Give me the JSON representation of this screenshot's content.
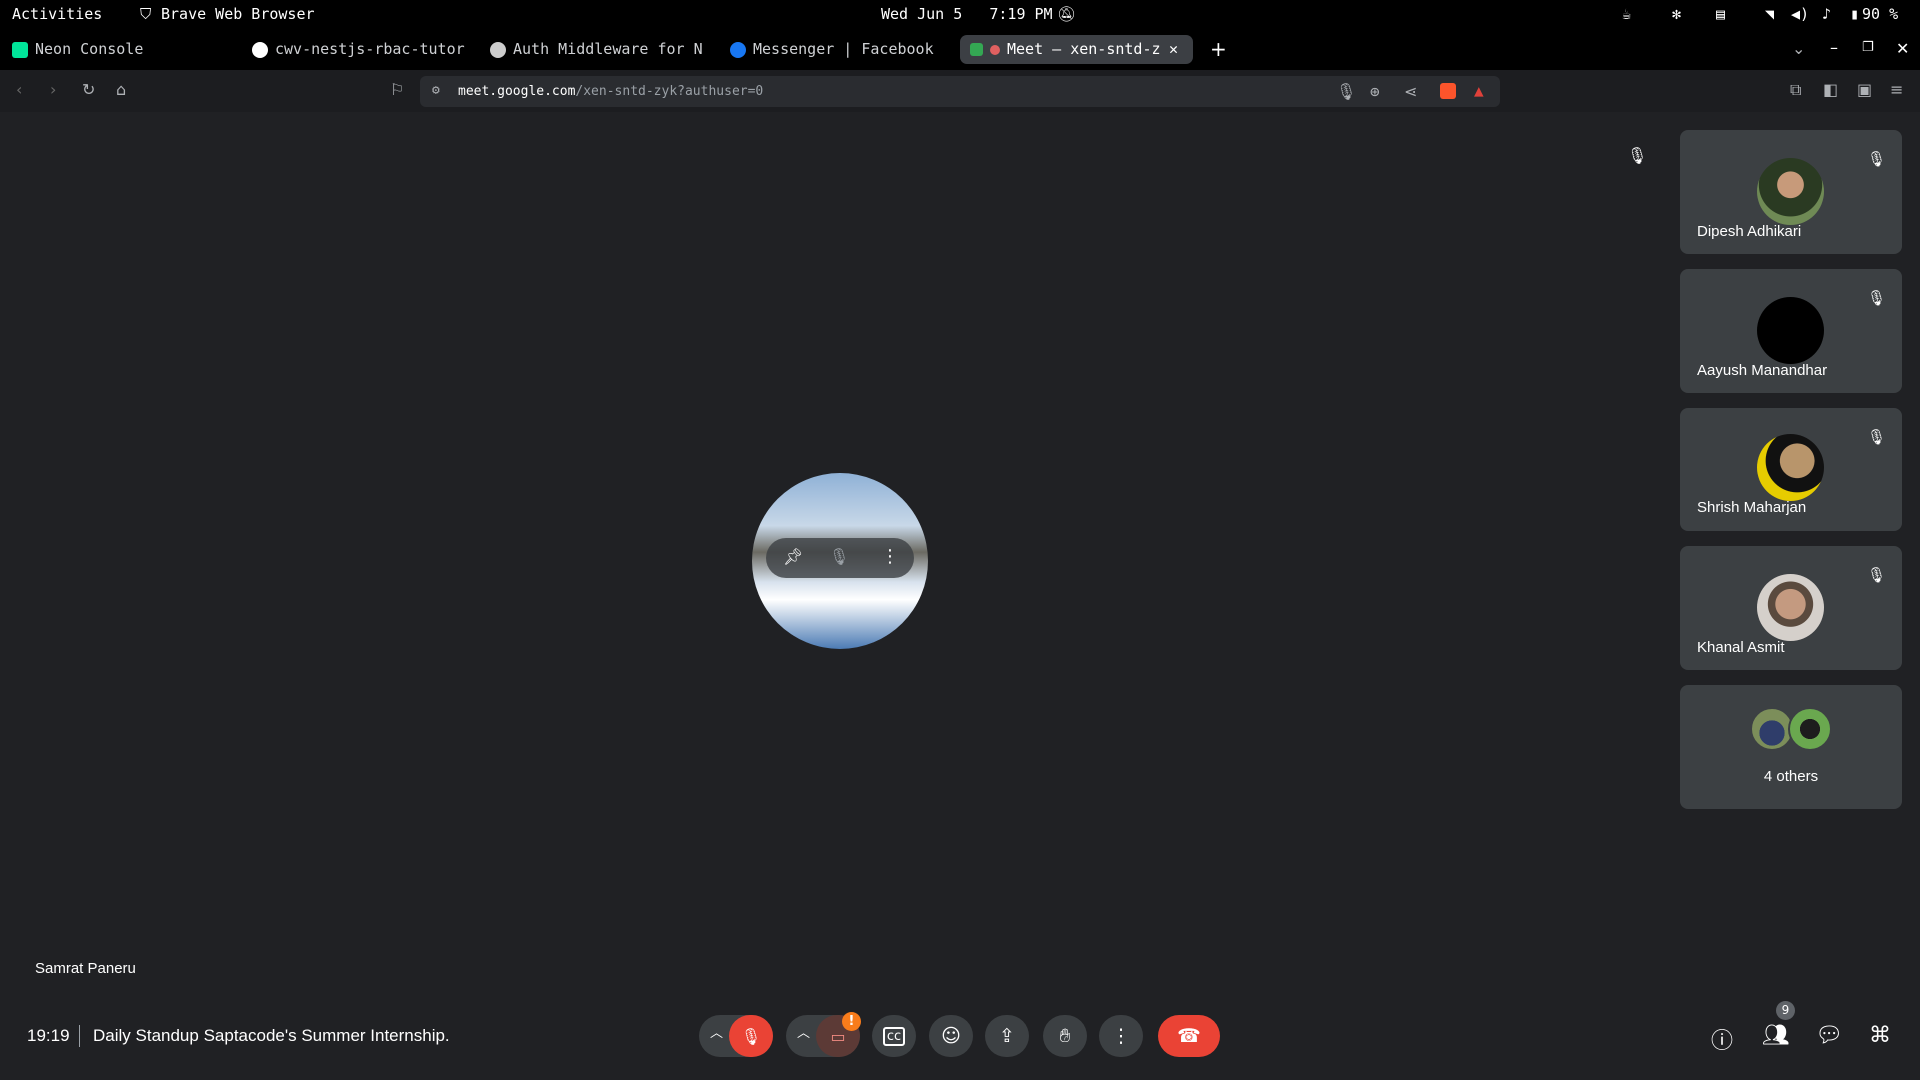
{
  "system": {
    "activities": "Activities",
    "app_name": "Brave Web Browser",
    "clock": "Wed Jun 5   7:19 PM",
    "battery": "90 %"
  },
  "tabs": [
    {
      "label": "Neon Console",
      "color": "#00e599"
    },
    {
      "label": "cwv-nestjs-rbac-tutor",
      "color": "#ffffff"
    },
    {
      "label": "Auth Middleware for N",
      "color": "#cccccc"
    },
    {
      "label": "Messenger | Facebook",
      "color": "#1877f2"
    },
    {
      "label": "Meet – xen-sntd-z",
      "color": "#34a853"
    }
  ],
  "address": {
    "host": "meet.google.com",
    "path": "/xen-sntd-zyk?authuser=0"
  },
  "participants": [
    {
      "name": "Dipesh Adhikari",
      "avatar_color": "#4a6b3a"
    },
    {
      "name": "Aayush Manandhar",
      "avatar_color": "#000000"
    },
    {
      "name": "Shrish Maharjan",
      "avatar_color": "#d9b400"
    },
    {
      "name": "Khanal Asmit",
      "avatar_color": "#b9b4ae"
    }
  ],
  "others_label": "4 others",
  "self_name": "Samrat Paneru",
  "meeting": {
    "time": "19:19",
    "title": "Daily Standup Saptacode's Summer Internship."
  },
  "people_count": "9",
  "colors": {
    "end_call": "#ea4335",
    "mic_off": "#ea4335",
    "warning": "#f97c1b"
  }
}
